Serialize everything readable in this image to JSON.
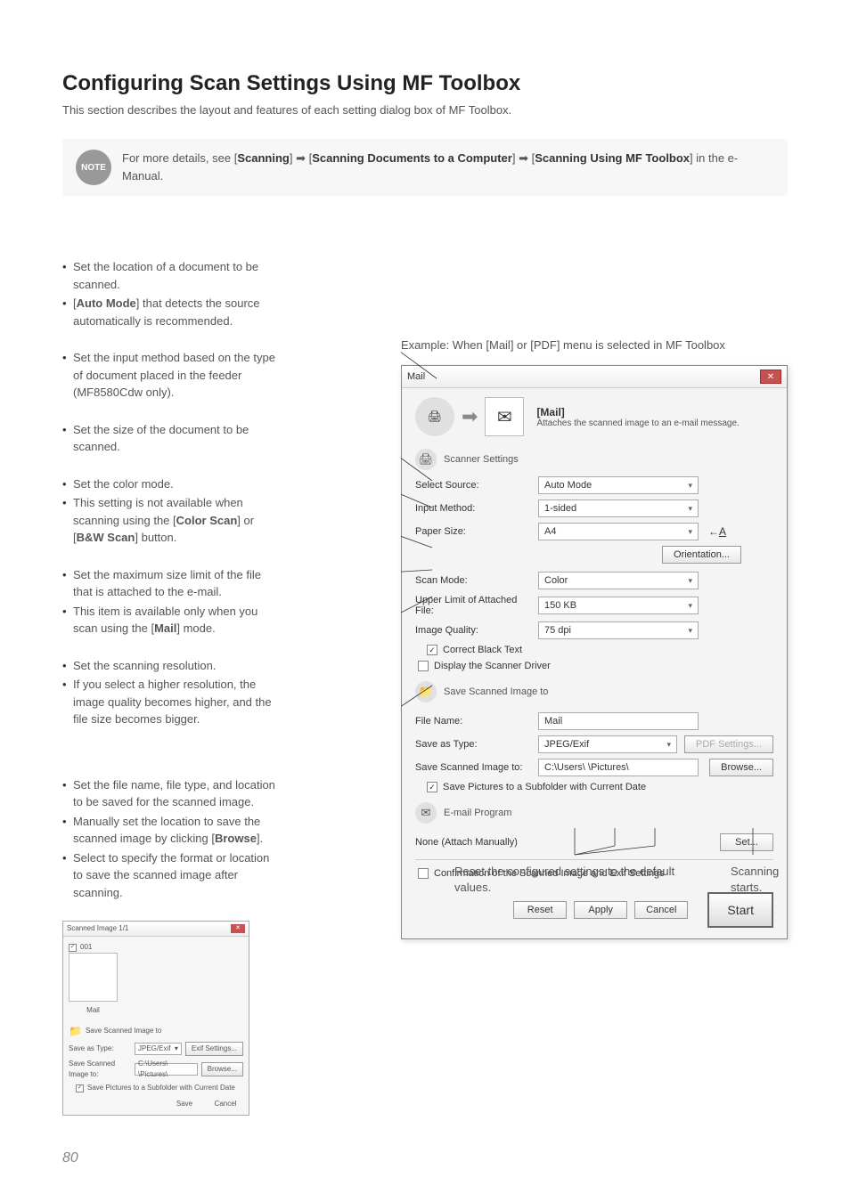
{
  "title": "Configuring Scan Settings Using MF Toolbox",
  "intro": "This section describes the layout and features of each setting dialog box of MF Toolbox.",
  "note": {
    "badge": "NOTE",
    "p1a": "For more details, see [",
    "p1b": "Scanning",
    "p1c": "] ",
    "p1d": " [",
    "p1e": "Scanning Documents to a Computer",
    "p1f": "] ",
    "p1g": " [",
    "p1h": "Scanning Using MF Toolbox",
    "p1i": "] in the e-Manual."
  },
  "bullets": {
    "g1": [
      "Set the location of a document to be scanned.",
      "[Auto Mode] that detects the source automatically is recommended."
    ],
    "g2": [
      "Set the input method based on the type of document placed in the feeder (MF8580Cdw only)."
    ],
    "g3": [
      "Set the size of the document to be scanned."
    ],
    "g4": [
      "Set the color mode.",
      "This setting is not available when scanning using the [Color Scan] or [B&W Scan] button."
    ],
    "g5": [
      "Set the maximum size limit of the file that is attached to the e-mail.",
      "This item is available only when you scan using the [Mail] mode."
    ],
    "g6": [
      "Set the scanning resolution.",
      "If you select a higher resolution, the image quality becomes higher, and the file size becomes bigger."
    ],
    "g7": [
      "Set the file name, file type, and location to be saved for the scanned image.",
      "Manually set the location to save the scanned image by clicking [Browse].",
      "Select to specify the format or location to save the scanned image after scanning."
    ]
  },
  "example_label": "Example: When [Mail] or [PDF] menu is selected in MF Toolbox",
  "dialog": {
    "title": "Mail",
    "header_title": "[Mail]",
    "header_sub": "Attaches the scanned image to an e-mail message.",
    "scanner_settings": "Scanner Settings",
    "select_source": {
      "label": "Select Source:",
      "value": "Auto Mode"
    },
    "input_method": {
      "label": "Input Method:",
      "value": "1-sided"
    },
    "paper_size": {
      "label": "Paper Size:",
      "value": "A4"
    },
    "orientation_btn": "Orientation...",
    "scan_mode": {
      "label": "Scan Mode:",
      "value": "Color"
    },
    "upper_limit": {
      "label": "Upper Limit of Attached File:",
      "value": "150 KB"
    },
    "image_quality": {
      "label": "Image Quality:",
      "value": "75 dpi"
    },
    "correct_black": "Correct Black Text",
    "display_driver": "Display the Scanner Driver",
    "save_section": "Save Scanned Image to",
    "file_name": {
      "label": "File Name:",
      "value": "Mail"
    },
    "save_as_type": {
      "label": "Save as Type:",
      "value": "JPEG/Exif"
    },
    "pdf_settings_btn": "PDF Settings...",
    "save_image_to": {
      "label": "Save Scanned Image to:",
      "value": "C:\\Users\\        \\Pictures\\"
    },
    "browse_btn": "Browse...",
    "save_subfolder": "Save Pictures to a Subfolder with Current Date",
    "email_program": "E-mail Program",
    "none_attach": "None (Attach Manually)",
    "set_btn": "Set...",
    "confirmation": "Confirmation of the Scanned Image and Exif Settings",
    "reset_btn": "Reset",
    "apply_btn": "Apply",
    "cancel_btn": "Cancel",
    "start_btn": "Start"
  },
  "callout_reset": "Reset the configured settings to the default values.",
  "callout_start": "Scanning starts.",
  "small_dialog": {
    "title": "Scanned Image 1/1",
    "checkbox_001": "001",
    "thumb_label": "Mail",
    "save_section": "Save Scanned Image to",
    "save_as_type": {
      "label": "Save as Type:",
      "value": "JPEG/Exif"
    },
    "exif_btn": "Exif Settings...",
    "save_image_to": {
      "label": "Save Scanned Image to:",
      "value": "C:\\Users\\    \\Pictures\\"
    },
    "browse_btn": "Browse...",
    "save_subfolder": "Save Pictures to a Subfolder with Current Date",
    "save_btn": "Save",
    "cancel_btn": "Cancel"
  },
  "page_number": "80"
}
